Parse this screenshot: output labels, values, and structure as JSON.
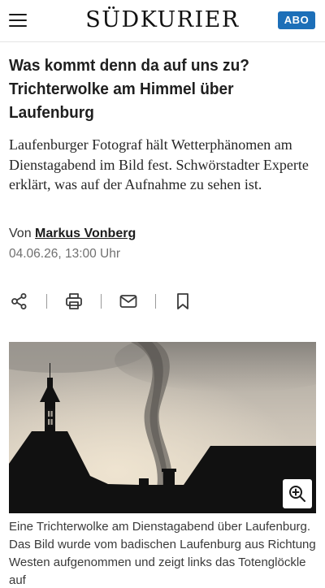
{
  "header": {
    "logo": "SÜDKURIER",
    "abo_label": "ABO"
  },
  "article": {
    "headline": "Was kommt denn da auf uns zu? Trichterwolke am Himmel über Laufenburg",
    "teaser": "Laufenburger Fotograf hält Wetterphänomen am Dienstagabend im Bild fest. Schwörstadter Experte erklärt, was auf der Aufnahme zu sehen ist.",
    "byline_prefix": "Von",
    "author": "Markus Vonberg",
    "date": "04.06.26, 13:00 Uhr",
    "caption": "Eine Trichterwolke am Dienstagabend über Laufenburg. Das Bild wurde vom badischen Laufenburg aus Richtung Westen aufgenommen und zeigt links das Totenglöckle auf"
  },
  "actions": [
    "share-icon",
    "print-icon",
    "mail-icon",
    "bookmark-icon"
  ],
  "colors": {
    "accent": "#1d6fb8",
    "text": "#1f1f1f",
    "muted": "#707070"
  }
}
